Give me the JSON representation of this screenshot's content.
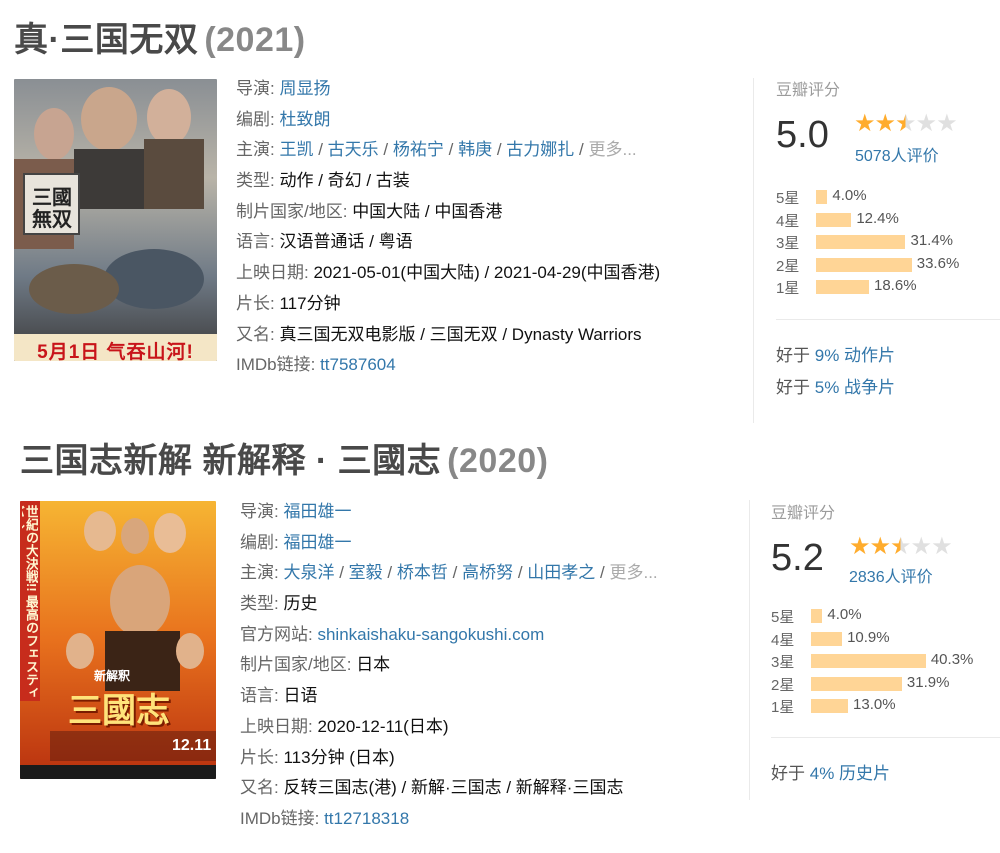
{
  "movies": [
    {
      "title": "真·三国无双",
      "year": "(2021)",
      "poster_caption": "5月1日 气吞山河!",
      "poster_logo": "三國無双",
      "director_label": "导演:",
      "director": "周显扬",
      "writer_label": "编剧:",
      "writer": "杜致朗",
      "cast_label": "主演:",
      "cast": [
        "王凯",
        "古天乐",
        "杨祐宁",
        "韩庚",
        "古力娜扎"
      ],
      "more": "更多...",
      "genre_label": "类型:",
      "genre": "动作 / 奇幻 / 古装",
      "country_label": "制片国家/地区:",
      "country": "中国大陆 / 中国香港",
      "language_label": "语言:",
      "language": "汉语普通话 / 粤语",
      "release_label": "上映日期:",
      "release": "2021-05-01(中国大陆) / 2021-04-29(中国香港)",
      "runtime_label": "片长:",
      "runtime": "117分钟",
      "aka_label": "又名:",
      "aka": "真三国无双电影版 / 三国无双 / Dynasty Warriors",
      "imdb_label": "IMDb链接:",
      "imdb": "tt7587604",
      "rating_label": "豆瓣评分",
      "score": "5.0",
      "stars_value": 2.5,
      "votes": "5078人评价",
      "dist": [
        {
          "label": "5星",
          "pct": "4.0%",
          "value": 4.0
        },
        {
          "label": "4星",
          "pct": "12.4%",
          "value": 12.4
        },
        {
          "label": "3星",
          "pct": "31.4%",
          "value": 31.4
        },
        {
          "label": "2星",
          "pct": "33.6%",
          "value": 33.6
        },
        {
          "label": "1星",
          "pct": "18.6%",
          "value": 18.6
        }
      ],
      "better": [
        {
          "prefix": "好于",
          "pct": "9%",
          "genre": "动作片"
        },
        {
          "prefix": "好于",
          "pct": "5%",
          "genre": "战争片"
        }
      ]
    },
    {
      "title": "三国志新解 新解释 · 三國志",
      "year": "(2020)",
      "poster_side": "世紀の大決戦!! 最高のフェスティバル!",
      "poster_logo_top": "新解釈",
      "poster_logo": "三國志",
      "poster_date": "12.11",
      "director_label": "导演:",
      "director": "福田雄一",
      "writer_label": "编剧:",
      "writer": "福田雄一",
      "cast_label": "主演:",
      "cast": [
        "大泉洋",
        "室毅",
        "桥本哲",
        "高桥努",
        "山田孝之"
      ],
      "more": "更多...",
      "genre_label": "类型:",
      "genre": "历史",
      "site_label": "官方网站:",
      "site": "shinkaishaku-sangokushi.com",
      "country_label": "制片国家/地区:",
      "country": "日本",
      "language_label": "语言:",
      "language": "日语",
      "release_label": "上映日期:",
      "release": "2020-12-11(日本)",
      "runtime_label": "片长:",
      "runtime": "113分钟 (日本)",
      "aka_label": "又名:",
      "aka": "反转三国志(港) / 新解·三国志 / 新解释·三国志",
      "imdb_label": "IMDb链接:",
      "imdb": "tt12718318",
      "rating_label": "豆瓣评分",
      "score": "5.2",
      "stars_value": 2.5,
      "votes": "2836人评价",
      "dist": [
        {
          "label": "5星",
          "pct": "4.0%",
          "value": 4.0
        },
        {
          "label": "4星",
          "pct": "10.9%",
          "value": 10.9
        },
        {
          "label": "3星",
          "pct": "40.3%",
          "value": 40.3
        },
        {
          "label": "2星",
          "pct": "31.9%",
          "value": 31.9
        },
        {
          "label": "1星",
          "pct": "13.0%",
          "value": 13.0
        }
      ],
      "better": [
        {
          "prefix": "好于",
          "pct": "4%",
          "genre": "历史片"
        }
      ]
    }
  ],
  "colors": {
    "link": "#3377aa",
    "bar": "#ffd596",
    "star_on": "#ffac2d",
    "star_off": "#e0e0e0"
  }
}
